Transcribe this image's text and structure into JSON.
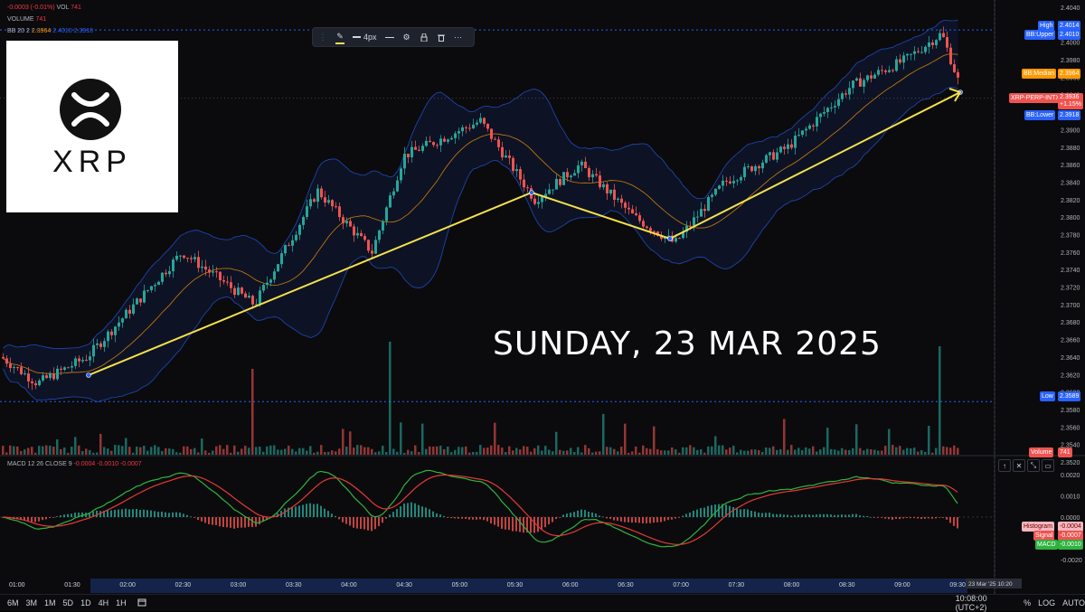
{
  "legend": {
    "change": "-0.0003 (-0.01%)",
    "vol_label": "VOL",
    "vol_value": "741",
    "volume_label": "VOLUME",
    "volume_value": "741",
    "bb_label": "BB 20 2",
    "bb_median": "2.3964",
    "bb_upper": "2.4010",
    "bb_lower": "2.3918",
    "macd_label": "MACD 12 26 CLOSE 9",
    "macd_hist": "-0.0004",
    "macd_macd": "-0.0010",
    "macd_signal": "-0.0007"
  },
  "toolbar": {
    "width_label": "4px"
  },
  "logo": {
    "text": "XRP"
  },
  "headline": "SUNDAY, 23 MAR 2025",
  "price_axis": {
    "ticks": [
      "2.4040",
      "2.4000",
      "2.3980",
      "2.3960",
      "2.3940",
      "2.3920",
      "2.3900",
      "2.3880",
      "2.3860",
      "2.3840",
      "2.3820",
      "2.3800",
      "2.3780",
      "2.3760",
      "2.3740",
      "2.3720",
      "2.3700",
      "2.3680",
      "2.3660",
      "2.3640",
      "2.3620",
      "2.3600",
      "2.3580",
      "2.3560",
      "2.3540",
      "2.3520"
    ],
    "tags": {
      "high_label": "High",
      "high_value": "2.4014",
      "bbupper_label": "BB:Upper",
      "bbupper_value": "2.4010",
      "bbmedian_label": "BB:Median",
      "bbmedian_value": "2.3964",
      "symbol_label": "XRP-PERP-INTX",
      "symbol_value": "2.3936",
      "symbol_pct": "+1.15%",
      "bblower_label": "BB:Lower",
      "bblower_value": "2.3918",
      "low_label": "Low",
      "low_value": "2.3589",
      "volume_label": "Volume",
      "volume_value": "741"
    }
  },
  "macd_axis": {
    "ticks": [
      "0.0020",
      "0.0010",
      "0.0000",
      "-0.0010",
      "-0.0020"
    ],
    "tags": {
      "hist_label": "Histogram",
      "hist_value": "-0.0004",
      "signal_label": "Signal",
      "signal_value": "-0.0007",
      "macd_label": "MACD",
      "macd_value": "-0.0010"
    }
  },
  "time_axis": {
    "labels": [
      "01:00",
      "01:30",
      "02:00",
      "02:30",
      "03:00",
      "03:30",
      "04:00",
      "04:30",
      "05:00",
      "05:30",
      "06:00",
      "06:30",
      "07:00",
      "07:30",
      "08:00",
      "08:30",
      "09:00",
      "09:30",
      "10:00"
    ],
    "cursor_date": "23 Mar '25",
    "cursor_time": "10:20"
  },
  "bottom_bar": {
    "ranges": [
      "6M",
      "3M",
      "1M",
      "5D",
      "1D",
      "4H",
      "1H"
    ],
    "clock": "10:08:00 (UTC+2)",
    "pct": "%",
    "log": "LOG",
    "auto": "AUTO"
  },
  "colors": {
    "up": "#26a69a",
    "down": "#ef5350",
    "trendline": "#f5e14a",
    "bb_band": "#2962ff",
    "bb_median": "#ff9800",
    "macd_line": "#2fb33f",
    "signal_line": "#e53935"
  },
  "icons": [
    "pencil-icon",
    "line-width-icon",
    "line-style-icon",
    "settings-icon",
    "lock-icon",
    "trash-icon",
    "more-icon",
    "calendar-icon",
    "arrow-up-icon",
    "close-icon",
    "collapse-icon",
    "maximize-icon"
  ]
}
